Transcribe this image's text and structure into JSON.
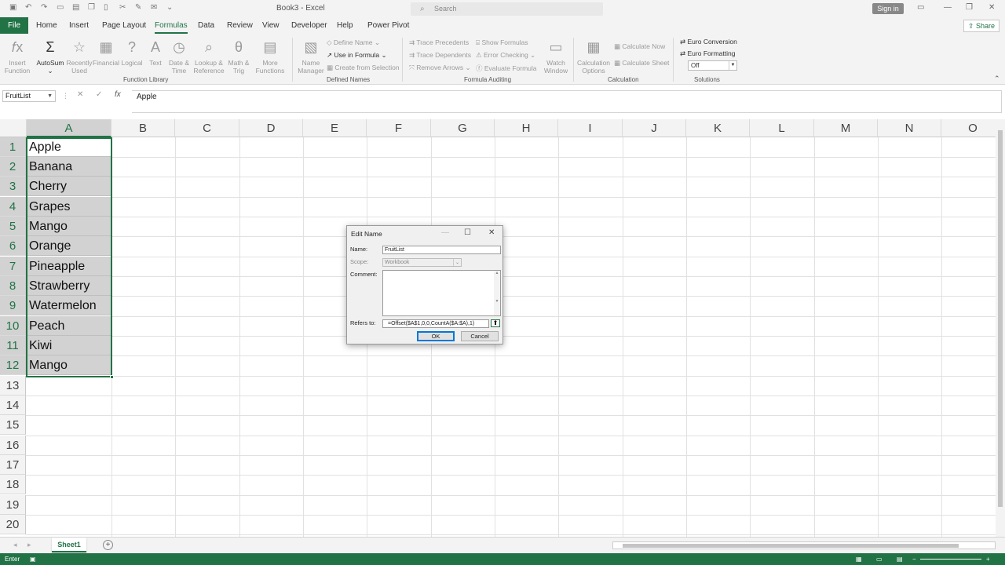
{
  "app": {
    "doc_title": "Book3 - Excel",
    "search_placeholder": "Search",
    "signin": "Sign in",
    "share": "Share"
  },
  "tabs": [
    "File",
    "Home",
    "Insert",
    "Page Layout",
    "Formulas",
    "Data",
    "Review",
    "View",
    "Developer",
    "Help",
    "Power Pivot"
  ],
  "ribbon": {
    "insert_function": [
      "Insert",
      "Function"
    ],
    "autosum": "AutoSum",
    "recently_used": [
      "Recently",
      "Used"
    ],
    "financial": "Financial",
    "logical": "Logical",
    "text": "Text",
    "date_time": [
      "Date &",
      "Time"
    ],
    "lookup": [
      "Lookup &",
      "Reference"
    ],
    "math_trig": [
      "Math &",
      "Trig"
    ],
    "more_functions": [
      "More",
      "Functions"
    ],
    "group_function_library": "Function Library",
    "name_manager": [
      "Name",
      "Manager"
    ],
    "define_name": "Define Name",
    "use_in_formula": "Use in Formula",
    "create_from_selection": "Create from Selection",
    "group_defined_names": "Defined Names",
    "trace_precedents": "Trace Precedents",
    "trace_dependents": "Trace Dependents",
    "remove_arrows": "Remove Arrows",
    "show_formulas": "Show Formulas",
    "error_checking": "Error Checking",
    "evaluate_formula": "Evaluate Formula",
    "watch_window": [
      "Watch",
      "Window"
    ],
    "group_formula_auditing": "Formula Auditing",
    "calculation_options": [
      "Calculation",
      "Options"
    ],
    "calculate_now": "Calculate Now",
    "calculate_sheet": "Calculate Sheet",
    "group_calculation": "Calculation",
    "euro_conversion": "Euro Conversion",
    "euro_formatting": "Euro Formatting",
    "euro_select": "Off",
    "group_solutions": "Solutions"
  },
  "formula_bar": {
    "name_box": "FruitList",
    "content": "Apple"
  },
  "columns": [
    "A",
    "B",
    "C",
    "D",
    "E",
    "F",
    "G",
    "H",
    "I",
    "J",
    "K",
    "L",
    "M",
    "N",
    "O"
  ],
  "rows": [
    "1",
    "2",
    "3",
    "4",
    "5",
    "6",
    "7",
    "8",
    "9",
    "10",
    "11",
    "12",
    "13",
    "14",
    "15",
    "16",
    "17",
    "18",
    "19",
    "20"
  ],
  "cells_a": [
    "Apple",
    "Banana",
    "Cherry",
    "Grapes",
    "Mango",
    "Orange",
    "Pineapple",
    "Strawberry",
    "Watermelon",
    "Peach",
    "Kiwi",
    "Mango"
  ],
  "sheet_tab": "Sheet1",
  "status": "Enter",
  "dialog": {
    "title": "Edit Name",
    "name_label": "Name:",
    "name_value": "FruitList",
    "scope_label": "Scope:",
    "scope_value": "Workbook",
    "comment_label": "Comment:",
    "refers_label": "Refers to:",
    "refers_value": "=Offset($A$1,0,0,CountA($A:$A),1)",
    "ok": "OK",
    "cancel": "Cancel"
  }
}
